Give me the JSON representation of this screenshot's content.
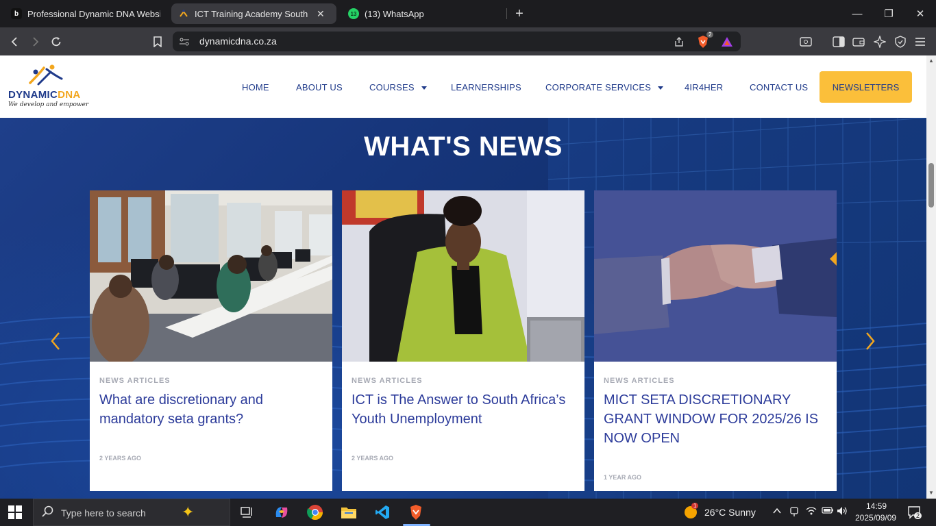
{
  "browser": {
    "tabs": [
      {
        "title": "Professional Dynamic DNA Website",
        "favicon": "b",
        "active": false
      },
      {
        "title": "ICT Training Academy South Afri",
        "favicon": "dna",
        "active": true
      },
      {
        "title": "(13) WhatsApp",
        "favicon": "13",
        "active": false
      }
    ],
    "close_label": "✕",
    "new_tab": "+",
    "url": "dynamicdna.co.za",
    "brave_badge": "2",
    "window_controls": {
      "minimize": "—",
      "maximize": "❐",
      "close": "✕"
    }
  },
  "site": {
    "logo": {
      "word1": "DYNAMIC",
      "word2": "DNA",
      "tagline": "We develop and empower"
    },
    "nav": [
      {
        "label": "HOME",
        "dropdown": false
      },
      {
        "label": "ABOUT US",
        "dropdown": false
      },
      {
        "label": "COURSES",
        "dropdown": true
      },
      {
        "label": "LEARNERSHIPS",
        "dropdown": false
      },
      {
        "label": "CORPORATE SERVICES",
        "dropdown": true
      },
      {
        "label": "4IR4HER",
        "dropdown": false
      },
      {
        "label": "CONTACT US",
        "dropdown": false
      }
    ],
    "newsletter_label": "NEWSLETTERS",
    "section_title": "WHAT'S NEWS",
    "cards": [
      {
        "category": "NEWS ARTICLES",
        "title": "What are discretionary and mandatory seta grants?",
        "date": "2 YEARS AGO",
        "image": "computer-lab-students"
      },
      {
        "category": "NEWS ARTICLES",
        "title": "ICT is The Answer to South Africa’s Youth Unemployment",
        "date": "2 YEARS AGO",
        "image": "woman-in-office-chair"
      },
      {
        "category": "NEWS ARTICLES",
        "title": "MICT SETA DISCRETIONARY GRANT WINDOW FOR 2025/26 IS NOW OPEN",
        "date": "1 YEAR AGO",
        "image": "handshake"
      }
    ],
    "prev_arrow": "‹",
    "next_arrow": "›",
    "colors": {
      "brand_blue": "#1f3a8a",
      "accent_yellow": "#fbbf3a",
      "card_title": "#2c3b9a"
    }
  },
  "taskbar": {
    "search_placeholder": "Type here to search",
    "weather_badge": "1",
    "weather": "26°C  Sunny",
    "time": "14:59",
    "date": "2025/09/09",
    "notification_count": "2"
  }
}
